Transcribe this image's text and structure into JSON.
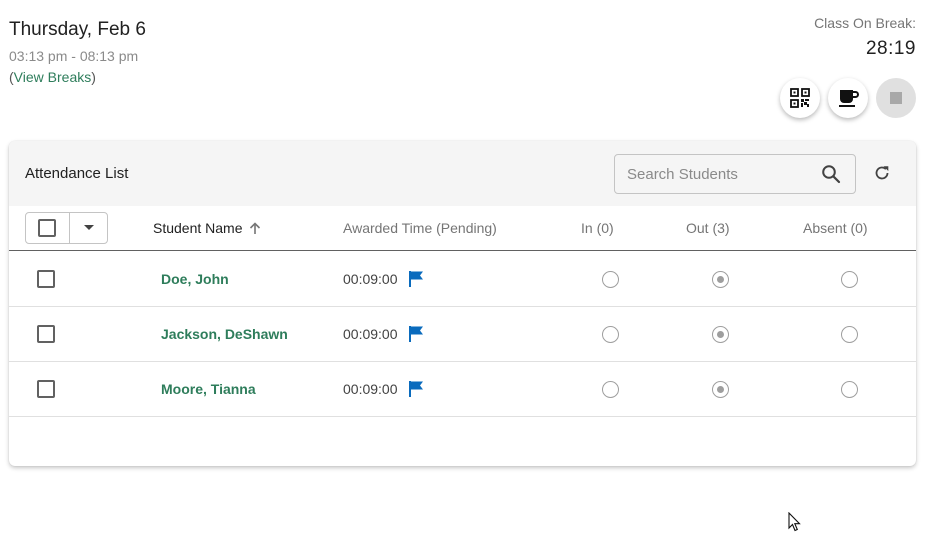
{
  "header": {
    "date": "Thursday, Feb 6",
    "time_range": "03:13 pm - 08:13 pm",
    "view_breaks_open": "(",
    "view_breaks_label": "View Breaks",
    "view_breaks_close": ")"
  },
  "break_status": {
    "label": "Class On Break:",
    "timer": "28:19"
  },
  "actions": [
    {
      "icon": "qr-code-icon"
    },
    {
      "icon": "coffee-cup-icon"
    },
    {
      "icon": "stop-icon",
      "disabled": true
    }
  ],
  "attendance": {
    "title": "Attendance List",
    "search_placeholder": "Search Students",
    "columns": {
      "name": "Student Name",
      "awarded": "Awarded Time (Pending)",
      "in": "In (0)",
      "out": "Out (3)",
      "absent": "Absent (0)"
    },
    "sort": {
      "column": "name",
      "direction": "ascending"
    },
    "rows": [
      {
        "name": "Doe, John",
        "awarded": "00:09:00",
        "status": "out"
      },
      {
        "name": "Jackson, DeShawn",
        "awarded": "00:09:00",
        "status": "out"
      },
      {
        "name": "Moore, Tianna",
        "awarded": "00:09:00",
        "status": "out"
      }
    ]
  },
  "colors": {
    "link_green": "#2e7d5b",
    "flag_blue": "#0a6bbd",
    "header_bg": "#f5f5f5"
  }
}
